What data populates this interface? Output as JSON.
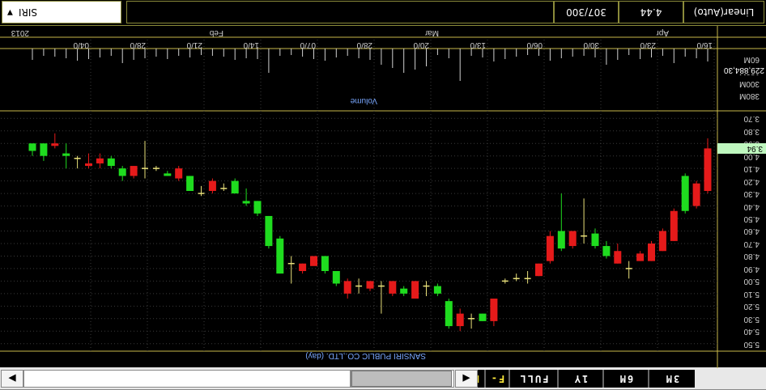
{
  "toolbar": {
    "zoom_in_label": "F+",
    "zoom_out_label": "F-",
    "full_label": "FULL",
    "range_1y_label": "1Y",
    "range_6m_label": "6M",
    "range_3m_label": "3M",
    "nav_left_icon": "arrow-left-icon",
    "nav_right_icon": "arrow-right-icon"
  },
  "status": {
    "symbol": "SIRI",
    "bar_count": "307/300",
    "last_price": "4.44",
    "scale_mode": "Linear(Auto)"
  },
  "chart": {
    "title": "SANSIRI PUBLIC CO.,LTD. (day)",
    "volume_title": "Volume",
    "current_price_badge": "3.94",
    "volume_readout": "229,884,30",
    "colors": {
      "up": "#1fdc1f",
      "down": "#e51a1a",
      "doji": "#e8e07a",
      "grid": "#3a3a3a",
      "panel_line": "#c8b84a"
    }
  },
  "chart_data": [
    {
      "type": "candlestick",
      "title": "SANSIRI PUBLIC CO.,LTD. (day)",
      "price_axis_ticks": [
        "3.70",
        "3.80",
        "3.90",
        "4.00",
        "4.10",
        "4.20",
        "4.30",
        "4.40",
        "4.50",
        "4.60",
        "4.70",
        "4.80",
        "4.90",
        "5.00",
        "5.10",
        "5.20",
        "5.30",
        "5.40",
        "5.50"
      ],
      "price_axis_inverted": true,
      "ylim": [
        3.64,
        5.56
      ],
      "month_labels": [
        "2013",
        "Feb",
        "Mar",
        "Apr"
      ],
      "date_labels": [
        "16/0",
        "23/0",
        "30/0",
        "06/0",
        "13/0",
        "20/0",
        "28/0",
        "07/0",
        "14/0",
        "21/0",
        "28/0",
        "04/0"
      ],
      "candles": [
        {
          "o": 3.96,
          "h": 3.94,
          "c": 3.9,
          "l": 4.0,
          "t": "up"
        },
        {
          "o": 4.0,
          "h": 3.96,
          "c": 3.9,
          "l": 4.04,
          "t": "up"
        },
        {
          "o": 3.9,
          "h": 3.82,
          "c": 3.92,
          "l": 3.94,
          "t": "dn"
        },
        {
          "o": 3.98,
          "h": 3.9,
          "c": 4.0,
          "l": 4.1,
          "t": "up"
        },
        {
          "o": 4.02,
          "h": 4.0,
          "c": 4.02,
          "l": 4.1,
          "t": "dj"
        },
        {
          "o": 4.06,
          "h": 3.98,
          "c": 4.08,
          "l": 4.1,
          "t": "dn"
        },
        {
          "o": 4.02,
          "h": 3.98,
          "c": 4.06,
          "l": 4.1,
          "t": "dn"
        },
        {
          "o": 4.08,
          "h": 4.0,
          "c": 4.02,
          "l": 4.1,
          "t": "up"
        },
        {
          "o": 4.16,
          "h": 4.08,
          "c": 4.1,
          "l": 4.2,
          "t": "up"
        },
        {
          "o": 4.08,
          "h": 4.08,
          "c": 4.16,
          "l": 4.18,
          "t": "dn"
        },
        {
          "o": 4.1,
          "h": 3.88,
          "c": 4.1,
          "l": 4.18,
          "t": "dj"
        },
        {
          "o": 4.1,
          "h": 4.08,
          "c": 4.1,
          "l": 4.12,
          "t": "dj"
        },
        {
          "o": 4.16,
          "h": 4.12,
          "c": 4.14,
          "l": 4.16,
          "t": "up"
        },
        {
          "o": 4.1,
          "h": 4.08,
          "c": 4.18,
          "l": 4.2,
          "t": "dn"
        },
        {
          "o": 4.28,
          "h": 4.16,
          "c": 4.16,
          "l": 4.28,
          "t": "up"
        },
        {
          "o": 4.3,
          "h": 4.24,
          "c": 4.3,
          "l": 4.32,
          "t": "dj"
        },
        {
          "o": 4.2,
          "h": 4.18,
          "c": 4.28,
          "l": 4.3,
          "t": "dn"
        },
        {
          "o": 4.26,
          "h": 4.22,
          "c": 4.26,
          "l": 4.28,
          "t": "dj"
        },
        {
          "o": 4.3,
          "h": 4.18,
          "c": 4.2,
          "l": 4.3,
          "t": "up"
        },
        {
          "o": 4.38,
          "h": 4.26,
          "c": 4.36,
          "l": 4.4,
          "t": "up"
        },
        {
          "o": 4.46,
          "h": 4.36,
          "c": 4.36,
          "l": 4.48,
          "t": "up"
        },
        {
          "o": 4.72,
          "h": 4.48,
          "c": 4.48,
          "l": 4.74,
          "t": "up"
        },
        {
          "o": 4.94,
          "h": 4.64,
          "c": 4.66,
          "l": 4.94,
          "t": "up"
        },
        {
          "o": 4.86,
          "h": 4.8,
          "c": 4.86,
          "l": 5.02,
          "t": "dj"
        },
        {
          "o": 4.92,
          "h": 4.86,
          "c": 4.86,
          "l": 4.94,
          "t": "dn"
        },
        {
          "o": 4.88,
          "h": 4.8,
          "c": 4.8,
          "l": 4.86,
          "t": "dn"
        },
        {
          "o": 4.92,
          "h": 4.82,
          "c": 4.8,
          "l": 4.94,
          "t": "up"
        },
        {
          "o": 5.02,
          "h": 4.92,
          "c": 4.92,
          "l": 5.04,
          "t": "up"
        },
        {
          "o": 5.1,
          "h": 4.98,
          "c": 5.0,
          "l": 5.14,
          "t": "dn"
        },
        {
          "o": 5.04,
          "h": 4.98,
          "c": 5.04,
          "l": 5.1,
          "t": "dj"
        },
        {
          "o": 5.06,
          "h": 5.0,
          "c": 5.0,
          "l": 5.08,
          "t": "dn"
        },
        {
          "o": 5.04,
          "h": 5.0,
          "c": 5.04,
          "l": 5.26,
          "t": "dj"
        },
        {
          "o": 5.1,
          "h": 5.0,
          "c": 5.0,
          "l": 5.12,
          "t": "dn"
        },
        {
          "o": 5.1,
          "h": 5.04,
          "c": 5.06,
          "l": 5.12,
          "t": "up"
        },
        {
          "o": 5.14,
          "h": 5.0,
          "c": 5.0,
          "l": 5.14,
          "t": "dn"
        },
        {
          "o": 5.04,
          "h": 5.0,
          "c": 5.04,
          "l": 5.12,
          "t": "dj"
        },
        {
          "o": 5.1,
          "h": 5.02,
          "c": 5.04,
          "l": 5.12,
          "t": "up"
        },
        {
          "o": 5.36,
          "h": 5.14,
          "c": 5.16,
          "l": 5.38,
          "t": "up"
        },
        {
          "o": 5.36,
          "h": 5.22,
          "c": 5.26,
          "l": 5.4,
          "t": "dn"
        },
        {
          "o": 5.3,
          "h": 5.26,
          "c": 5.3,
          "l": 5.38,
          "t": "dj"
        },
        {
          "o": 5.32,
          "h": 5.26,
          "c": 5.26,
          "l": 5.32,
          "t": "up"
        },
        {
          "o": 5.32,
          "h": 5.14,
          "c": 5.14,
          "l": 5.36,
          "t": "dn"
        },
        {
          "o": 5.0,
          "h": 4.98,
          "c": 5.0,
          "l": 5.02,
          "t": "dj"
        },
        {
          "o": 4.98,
          "h": 4.94,
          "c": 4.98,
          "l": 5.0,
          "t": "dj"
        },
        {
          "o": 4.96,
          "h": 4.92,
          "c": 4.98,
          "l": 5.02,
          "t": "dj"
        },
        {
          "o": 4.96,
          "h": 4.86,
          "c": 4.86,
          "l": 4.96,
          "t": "dn"
        },
        {
          "o": 4.84,
          "h": 4.6,
          "c": 4.64,
          "l": 4.86,
          "t": "dn"
        },
        {
          "o": 4.74,
          "h": 4.3,
          "c": 4.6,
          "l": 4.76,
          "t": "up"
        },
        {
          "o": 4.72,
          "h": 4.6,
          "c": 4.6,
          "l": 4.74,
          "t": "dn"
        },
        {
          "o": 4.64,
          "h": 4.34,
          "c": 4.6,
          "l": 4.7,
          "t": "dj"
        },
        {
          "o": 4.72,
          "h": 4.58,
          "c": 4.62,
          "l": 4.74,
          "t": "up"
        },
        {
          "o": 4.8,
          "h": 4.68,
          "c": 4.72,
          "l": 4.82,
          "t": "up"
        },
        {
          "o": 4.86,
          "h": 4.7,
          "c": 4.76,
          "l": 4.86,
          "t": "dn"
        },
        {
          "o": 4.88,
          "h": 4.84,
          "c": 4.9,
          "l": 4.98,
          "t": "dj"
        },
        {
          "o": 4.84,
          "h": 4.76,
          "c": 4.78,
          "l": 4.84,
          "t": "dn"
        },
        {
          "o": 4.84,
          "h": 4.68,
          "c": 4.7,
          "l": 4.84,
          "t": "dn"
        },
        {
          "o": 4.76,
          "h": 4.58,
          "c": 4.6,
          "l": 4.76,
          "t": "dn"
        },
        {
          "o": 4.68,
          "h": 4.42,
          "c": 4.44,
          "l": 4.68,
          "t": "dn"
        },
        {
          "o": 4.44,
          "h": 4.14,
          "c": 4.16,
          "l": 4.46,
          "t": "up"
        },
        {
          "o": 4.4,
          "h": 4.2,
          "c": 4.22,
          "l": 4.42,
          "t": "dn"
        },
        {
          "o": 4.28,
          "h": 3.86,
          "c": 3.94,
          "l": 4.3,
          "t": "dn"
        }
      ],
      "volume_axis_ticks": [
        "60M",
        "120M",
        "300M",
        "380M"
      ]
    }
  ]
}
